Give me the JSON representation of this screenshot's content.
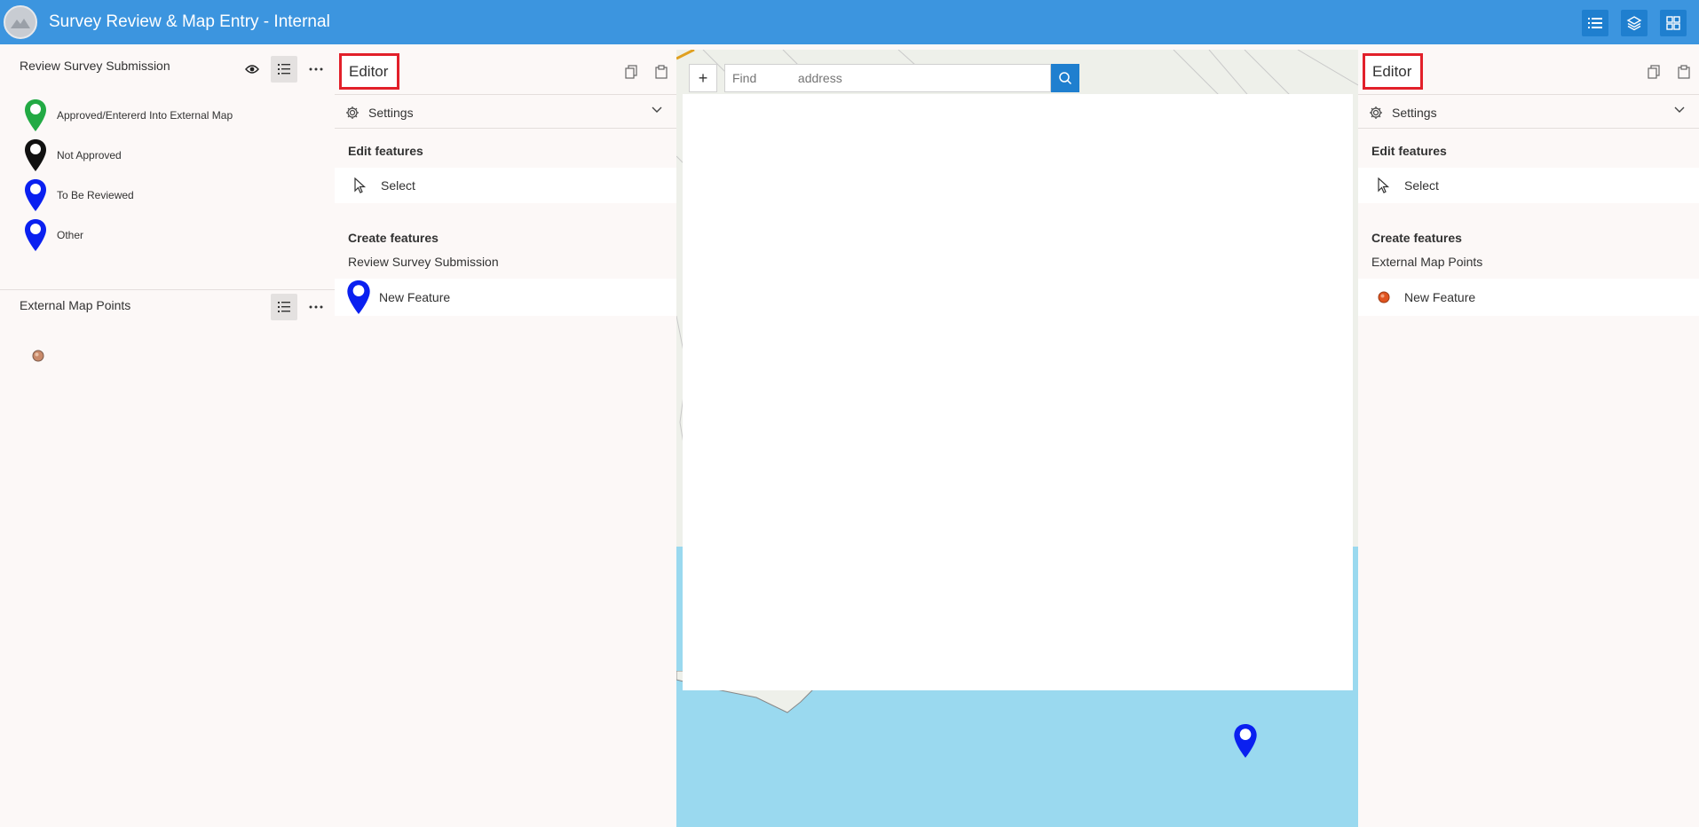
{
  "header": {
    "title": "Survey Review & Map Entry - Internal",
    "icons": [
      "list-icon",
      "layers-icon",
      "grid-icon"
    ]
  },
  "legend": {
    "layer1": {
      "title": "Review Survey Submission",
      "items": [
        {
          "label": "Approved/Entererd Into External Map",
          "color": "#22aa44"
        },
        {
          "label": "Not Approved",
          "color": "#111111"
        },
        {
          "label": "To Be Reviewed",
          "color": "#0a20f0"
        },
        {
          "label": "Other",
          "color": "#0a20f0"
        }
      ]
    },
    "layer2": {
      "title": "External Map Points"
    }
  },
  "editor1": {
    "title": "Editor",
    "settings_label": "Settings",
    "edit_features_label": "Edit features",
    "select_label": "Select",
    "create_features_label": "Create features",
    "layer_label": "Review Survey Submission",
    "new_feature_label": "New Feature"
  },
  "editor2": {
    "title": "Editor",
    "settings_label": "Settings",
    "edit_features_label": "Edit features",
    "select_label": "Select",
    "create_features_label": "Create features",
    "layer_label": "External Map Points",
    "new_feature_label": "New Feature"
  },
  "map": {
    "search_placeholder": "Find            address",
    "zoom_in_label": "+"
  },
  "colors": {
    "header": "#3c95df",
    "accent": "#1f7fcf",
    "highlight_border": "#e2202a",
    "water": "#9ad9ef"
  }
}
